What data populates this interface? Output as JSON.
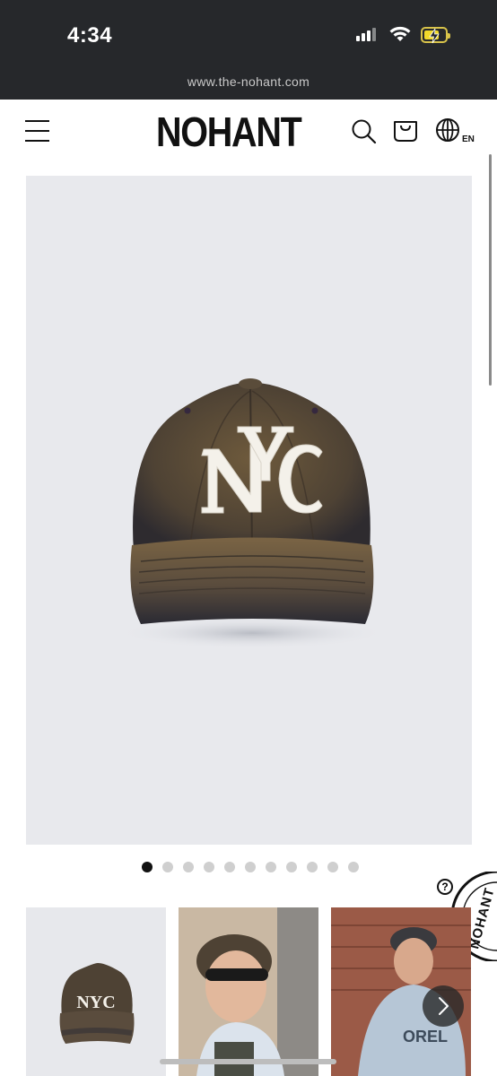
{
  "status_bar": {
    "time": "4:34",
    "url": "www.the-nohant.com",
    "battery_level": 0.6,
    "battery_color": "#f1d92b",
    "charging": true
  },
  "header": {
    "brand": "NOHANT",
    "language": "EN",
    "icons": [
      "hamburger-menu-icon",
      "search-icon",
      "shopping-bag-icon",
      "globe-icon"
    ]
  },
  "gallery": {
    "slide_count": 11,
    "active_slide": 1,
    "product_logo_text": "NYC",
    "thumbnail_count": 3
  },
  "floating": {
    "help_label": "?",
    "badge_text": "NOHANT"
  },
  "colors": {
    "status_bar_bg": "#26282b",
    "hero_bg": "#e8e9ed",
    "dot_active": "#111111",
    "dot_inactive": "#cfcfcf"
  }
}
